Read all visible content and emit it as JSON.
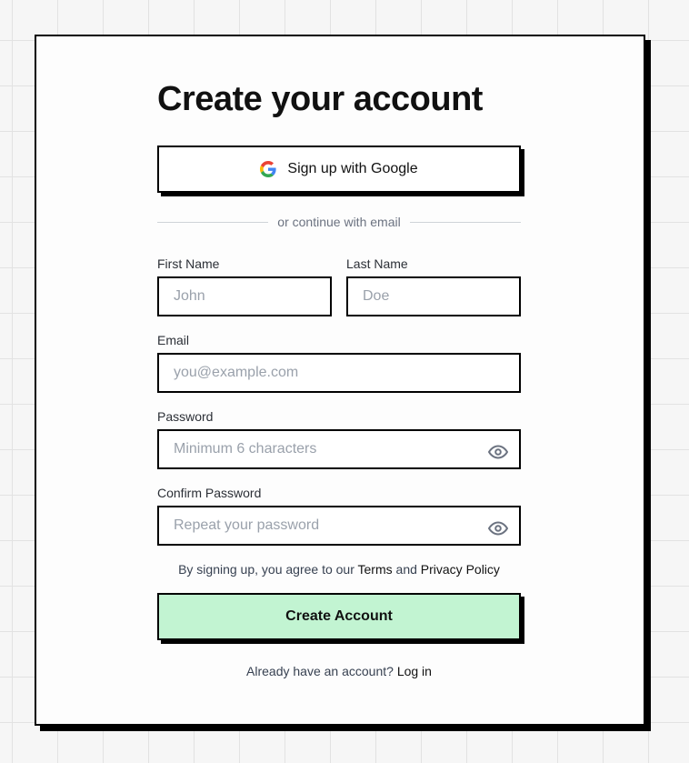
{
  "form": {
    "title": "Create your account",
    "google_button_label": "Sign up with Google",
    "divider_text": "or continue with email",
    "fields": {
      "first_name": {
        "label": "First Name",
        "placeholder": "John",
        "value": ""
      },
      "last_name": {
        "label": "Last Name",
        "placeholder": "Doe",
        "value": ""
      },
      "email": {
        "label": "Email",
        "placeholder": "you@example.com",
        "value": ""
      },
      "password": {
        "label": "Password",
        "placeholder": "Minimum 6 characters",
        "value": ""
      },
      "confirm_password": {
        "label": "Confirm Password",
        "placeholder": "Repeat your password",
        "value": ""
      }
    },
    "agreement": {
      "prefix": "By signing up, you agree to our",
      "terms_link": "Terms",
      "conjunction": "and",
      "privacy_link": "Privacy Policy"
    },
    "submit_label": "Create Account",
    "login_prompt": {
      "text": "Already have an account?",
      "link": "Log in"
    }
  },
  "icons": {
    "google": "google-logo-icon",
    "password_visibility": "eye-icon"
  },
  "colors": {
    "submit_background": "#c2f4d2",
    "border": "#000000",
    "placeholder": "#9aa1ab",
    "background_grid": "#e2e2e2"
  }
}
